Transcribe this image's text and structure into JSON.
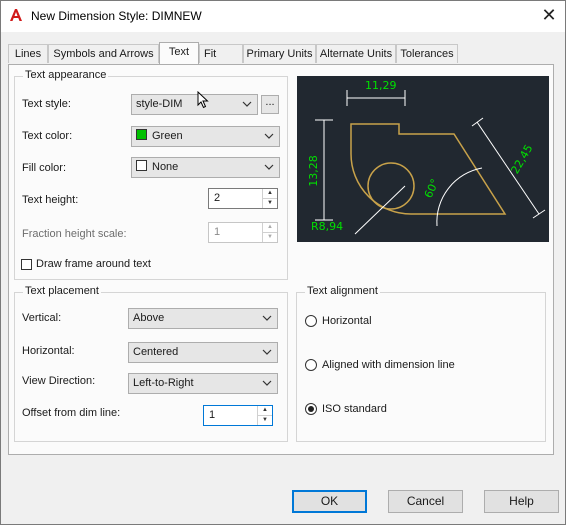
{
  "window": {
    "title": "New Dimension Style: DIMNEW",
    "close_glyph": "✕"
  },
  "tabs": [
    "Lines",
    "Symbols and Arrows",
    "Text",
    "Fit",
    "Primary Units",
    "Alternate Units",
    "Tolerances"
  ],
  "active_tab": "Text",
  "text_appearance": {
    "title": "Text appearance",
    "text_style_label": "Text style:",
    "text_style_value": "style-DIM",
    "browse_label": "...",
    "text_color_label": "Text color:",
    "text_color_value": "Green",
    "text_color_swatch": "#00c000",
    "fill_color_label": "Fill color:",
    "fill_color_value": "None",
    "text_height_label": "Text height:",
    "text_height_value": "2",
    "fraction_label": "Fraction height scale:",
    "fraction_value": "1",
    "draw_frame_label": "Draw frame around text",
    "draw_frame_checked": false
  },
  "text_placement": {
    "title": "Text placement",
    "vertical_label": "Vertical:",
    "vertical_value": "Above",
    "horizontal_label": "Horizontal:",
    "horizontal_value": "Centered",
    "view_direction_label": "View Direction:",
    "view_direction_value": "Left-to-Right",
    "offset_label": "Offset from dim line:",
    "offset_value": "1"
  },
  "text_alignment": {
    "title": "Text alignment",
    "options": [
      "Horizontal",
      "Aligned with dimension line",
      "ISO standard"
    ],
    "selected": "ISO standard"
  },
  "preview": {
    "dim_top": "11,29",
    "dim_left": "13,28",
    "dim_right": "22,45",
    "dim_angle": "60°",
    "dim_radius": "R8,94",
    "dim_color": "#00e000",
    "geometry_color": "#c8a24a",
    "line_color": "#ffffff"
  },
  "buttons": {
    "ok": "OK",
    "cancel": "Cancel",
    "help": "Help"
  }
}
